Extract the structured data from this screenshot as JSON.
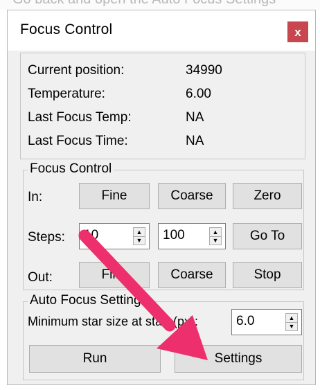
{
  "top_partial_text": "Go back and open the Auto Focus Settings",
  "window": {
    "title": "Focus Control",
    "close_glyph": "x"
  },
  "info": {
    "current_position_label": "Current position:",
    "current_position_value": "34990",
    "temperature_label": "Temperature:",
    "temperature_value": "6.00",
    "last_focus_temp_label": "Last Focus Temp:",
    "last_focus_temp_value": "NA",
    "last_focus_time_label": "Last Focus Time:",
    "last_focus_time_value": "NA"
  },
  "focus_control": {
    "group_title": "Focus Control",
    "in_label": "In:",
    "in_fine": "Fine",
    "in_coarse": "Coarse",
    "zero": "Zero",
    "steps_label": "Steps:",
    "fine_steps_value": "10",
    "coarse_steps_value": "100",
    "goto": "Go To",
    "out_label": "Out:",
    "out_fine": "Fine",
    "out_coarse": "Coarse",
    "stop": "Stop"
  },
  "auto_focus": {
    "group_title": "Auto Focus Settings",
    "min_star_label": "Minimum star size at start (px):",
    "min_star_value": "6.0",
    "run": "Run",
    "settings": "Settings"
  },
  "colors": {
    "close_button": "#c8464f",
    "annotation_arrow": "#ee2f6d",
    "window_bg": "#f0f0f0",
    "button_bg": "#e1e1e1"
  },
  "icons": {
    "close": "close-icon",
    "spin_up": "chevron-up-icon",
    "spin_down": "chevron-down-icon",
    "annotation": "arrow-annotation-icon"
  }
}
